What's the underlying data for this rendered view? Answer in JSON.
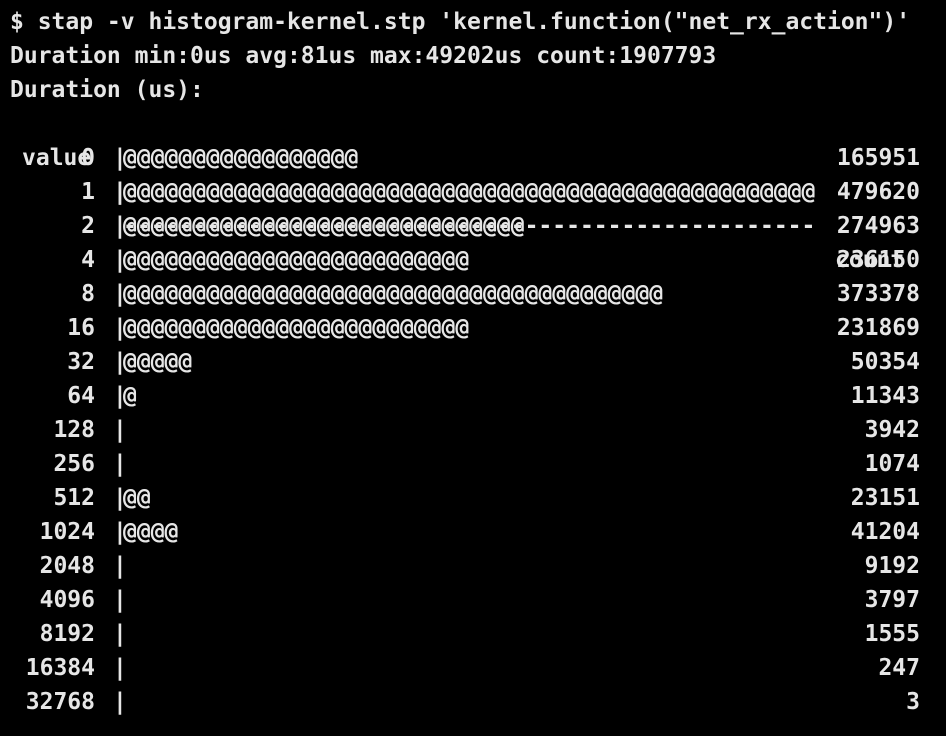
{
  "terminal": {
    "command": "$ stap -v histogram-kernel.stp 'kernel.function(\"net_rx_action\")'",
    "summary": "Duration min:0us avg:81us max:49202us count:1907793",
    "histogram_title": "Duration (us):",
    "header": {
      "value": "value",
      "separator": "|",
      "dashes": "--------------------------------------------------",
      "count": "count"
    },
    "rows": [
      {
        "value": "0",
        "bar": "@@@@@@@@@@@@@@@@@",
        "count": "165951"
      },
      {
        "value": "1",
        "bar": "@@@@@@@@@@@@@@@@@@@@@@@@@@@@@@@@@@@@@@@@@@@@@@@@@@",
        "count": "479620"
      },
      {
        "value": "2",
        "bar": "@@@@@@@@@@@@@@@@@@@@@@@@@@@@@",
        "count": "274963"
      },
      {
        "value": "4",
        "bar": "@@@@@@@@@@@@@@@@@@@@@@@@@",
        "count": "236150"
      },
      {
        "value": "8",
        "bar": "@@@@@@@@@@@@@@@@@@@@@@@@@@@@@@@@@@@@@@@",
        "count": "373378"
      },
      {
        "value": "16",
        "bar": "@@@@@@@@@@@@@@@@@@@@@@@@@",
        "count": "231869"
      },
      {
        "value": "32",
        "bar": "@@@@@",
        "count": "50354"
      },
      {
        "value": "64",
        "bar": "@",
        "count": "11343"
      },
      {
        "value": "128",
        "bar": "",
        "count": "3942"
      },
      {
        "value": "256",
        "bar": "",
        "count": "1074"
      },
      {
        "value": "512",
        "bar": "@@",
        "count": "23151"
      },
      {
        "value": "1024",
        "bar": "@@@@",
        "count": "41204"
      },
      {
        "value": "2048",
        "bar": "",
        "count": "9192"
      },
      {
        "value": "4096",
        "bar": "",
        "count": "3797"
      },
      {
        "value": "8192",
        "bar": "",
        "count": "1555"
      },
      {
        "value": "16384",
        "bar": "",
        "count": "247"
      },
      {
        "value": "32768",
        "bar": "",
        "count": "3"
      }
    ]
  },
  "colors": {
    "background": "#000000",
    "foreground": "#e6e6e6"
  }
}
